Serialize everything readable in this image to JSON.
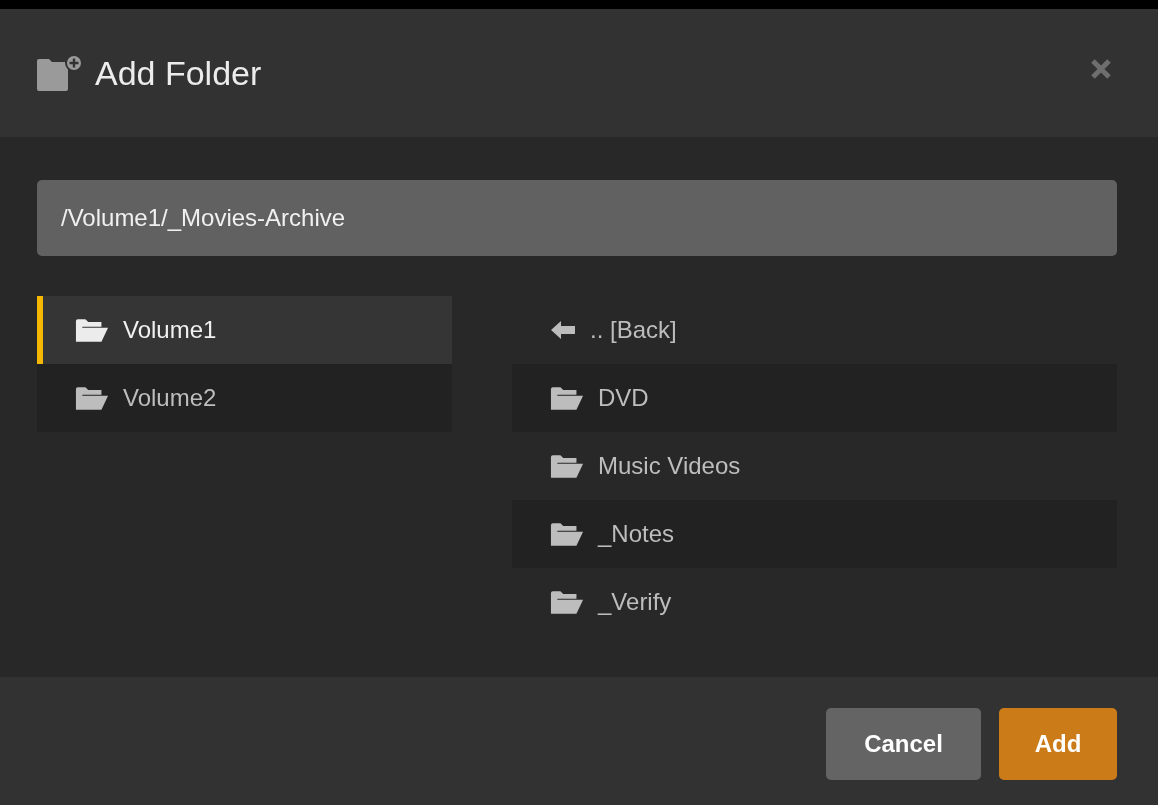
{
  "dialog": {
    "title": "Add Folder"
  },
  "path_field": {
    "value": "/Volume1/_Movies-Archive"
  },
  "volumes": [
    {
      "label": "Volume1",
      "selected": true
    },
    {
      "label": "Volume2",
      "selected": false
    }
  ],
  "folders": [
    {
      "kind": "back",
      "label": ".. [Back]"
    },
    {
      "kind": "folder",
      "label": "DVD"
    },
    {
      "kind": "folder",
      "label": "Music Videos"
    },
    {
      "kind": "folder",
      "label": "_Notes"
    },
    {
      "kind": "folder",
      "label": "_Verify"
    }
  ],
  "buttons": [
    {
      "kind": "secondary",
      "label": "Cancel"
    },
    {
      "kind": "primary",
      "label": "Add"
    }
  ]
}
